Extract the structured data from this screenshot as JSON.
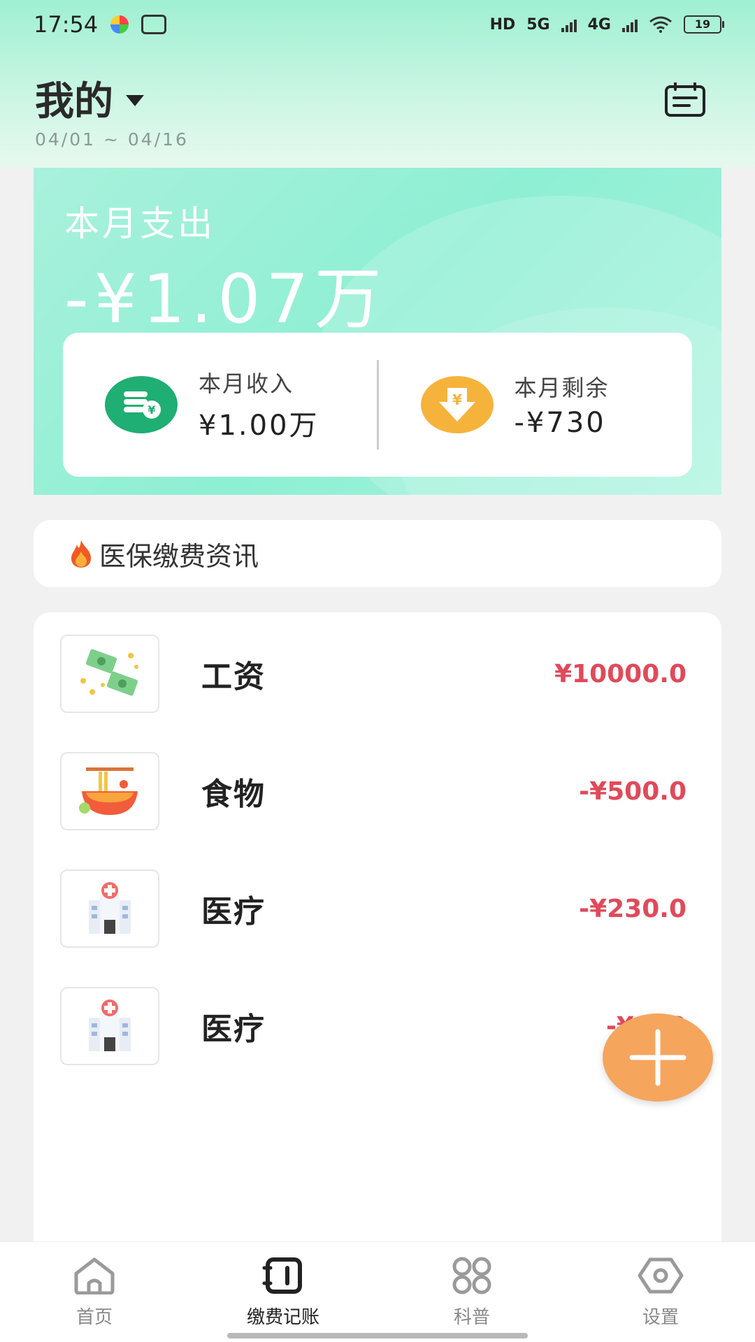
{
  "status_bar": {
    "time": "17:54",
    "battery": "19",
    "network_labels": [
      "HD",
      "5G",
      "4G"
    ]
  },
  "header": {
    "title": "我的",
    "date_range": "04/01 ~ 04/16"
  },
  "summary": {
    "expense_label": "本月支出",
    "expense_amount": "-¥1.07万",
    "income_label": "本月收入",
    "income_value": "¥1.00万",
    "remaining_label": "本月剩余",
    "remaining_value": "-¥730",
    "colors": {
      "card_bg": "#8eefd3",
      "income_icon": "#1fae73",
      "remaining_icon": "#f6b33c"
    }
  },
  "news": {
    "text": "医保缴费资讯"
  },
  "records": [
    {
      "name": "工资",
      "amount": "¥10000.0",
      "icon": "money-icon"
    },
    {
      "name": "食物",
      "amount": "-¥500.0",
      "icon": "noodle-bowl-icon"
    },
    {
      "name": "医疗",
      "amount": "-¥230.0",
      "icon": "hospital-icon"
    },
    {
      "name": "医疗",
      "amount": "-¥100",
      "icon": "hospital-icon"
    }
  ],
  "fab": {
    "icon": "plus-icon",
    "color": "#f6a55d"
  },
  "bottom_nav": [
    {
      "label": "首页",
      "icon": "home-icon"
    },
    {
      "label": "缴费记账",
      "icon": "ledger-icon",
      "active": true
    },
    {
      "label": "科普",
      "icon": "grid-icon"
    },
    {
      "label": "设置",
      "icon": "settings-icon"
    }
  ],
  "accent_amount_color": "#e04a5a"
}
